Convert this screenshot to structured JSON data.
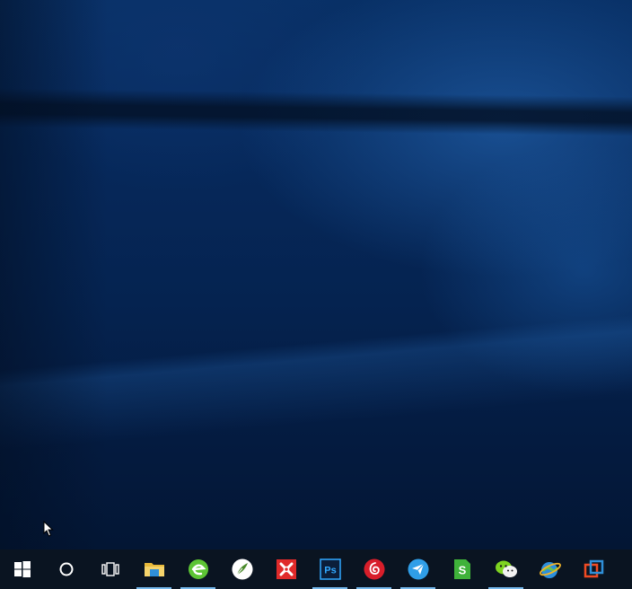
{
  "taskbar": {
    "start_button": {
      "icon": "windows-logo-icon"
    },
    "search_button": {
      "icon": "cortana-ring-icon"
    },
    "task_view_button": {
      "icon": "task-view-icon"
    },
    "pinned_apps": [
      {
        "name": "file-explorer",
        "icon": "folder-icon",
        "running": true
      },
      {
        "name": "browser-green",
        "icon": "green-e-browser-icon",
        "running": true
      },
      {
        "name": "pen-app",
        "icon": "feather-pen-icon",
        "running": false
      },
      {
        "name": "xmind",
        "icon": "red-x-icon",
        "running": false
      },
      {
        "name": "photoshop",
        "icon": "ps-icon",
        "label": "Ps",
        "running": true
      },
      {
        "name": "netease-music",
        "icon": "red-music-icon",
        "running": true
      },
      {
        "name": "paper-plane-app",
        "icon": "paper-plane-icon",
        "running": true
      },
      {
        "name": "green-s-app",
        "icon": "green-s-icon",
        "label": "S",
        "running": false
      },
      {
        "name": "wechat",
        "icon": "wechat-icon",
        "running": true
      },
      {
        "name": "internet-explorer",
        "icon": "ie-globe-icon",
        "running": false
      },
      {
        "name": "vmware",
        "icon": "vmware-icon",
        "running": false
      }
    ]
  },
  "colors": {
    "taskbar_bg": "#0a1421",
    "running_indicator": "#76b9ed"
  }
}
